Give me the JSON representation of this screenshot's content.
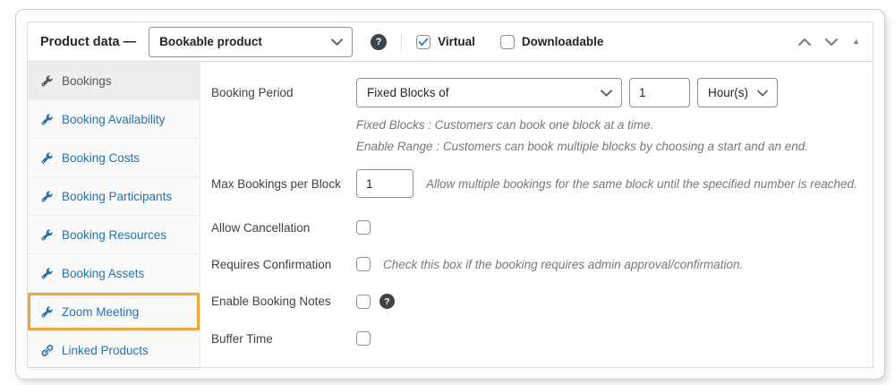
{
  "header": {
    "title": "Product data —",
    "product_type": {
      "value": "Bookable product"
    },
    "help_icon": "?",
    "virtual": {
      "label": "Virtual",
      "checked": true
    },
    "downloadable": {
      "label": "Downloadable",
      "checked": false
    },
    "collapse_icon": "▲"
  },
  "colors": {
    "link_blue": "#2271b1",
    "check_blue": "#3582c4",
    "highlight_orange": "#f0a43c",
    "active_tab_bg": "#eeeeee",
    "sidebar_bg": "#fafafa"
  },
  "sidebar": {
    "items": [
      {
        "label": "Bookings",
        "icon": "wrench-icon",
        "active": true
      },
      {
        "label": "Booking Availability",
        "icon": "wrench-icon",
        "active": false
      },
      {
        "label": "Booking Costs",
        "icon": "wrench-icon",
        "active": false
      },
      {
        "label": "Booking Participants",
        "icon": "wrench-icon",
        "active": false
      },
      {
        "label": "Booking Resources",
        "icon": "wrench-icon",
        "active": false
      },
      {
        "label": "Booking Assets",
        "icon": "wrench-icon",
        "active": false
      },
      {
        "label": "Zoom Meeting",
        "icon": "wrench-icon",
        "active": false,
        "highlighted": true
      },
      {
        "label": "Linked Products",
        "icon": "link-icon",
        "active": false
      }
    ]
  },
  "main": {
    "booking_period": {
      "label": "Booking Period",
      "type_value": "Fixed Blocks of",
      "count_value": "1",
      "unit_value": "Hour(s)",
      "desc_fixed": "Fixed Blocks : Customers can book one block at a time.",
      "desc_range": "Enable Range : Customers can book multiple blocks by choosing a start and an end."
    },
    "max_bookings": {
      "label": "Max Bookings per Block",
      "value": "1",
      "desc": "Allow multiple bookings for the same block until the specified number is reached."
    },
    "allow_cancellation": {
      "label": "Allow Cancellation",
      "checked": false
    },
    "requires_confirmation": {
      "label": "Requires Confirmation",
      "checked": false,
      "desc": "Check this box if the booking requires admin approval/confirmation."
    },
    "enable_booking_notes": {
      "label": "Enable Booking Notes",
      "checked": false,
      "help_icon": "?"
    },
    "buffer_time": {
      "label": "Buffer Time",
      "checked": false
    }
  }
}
